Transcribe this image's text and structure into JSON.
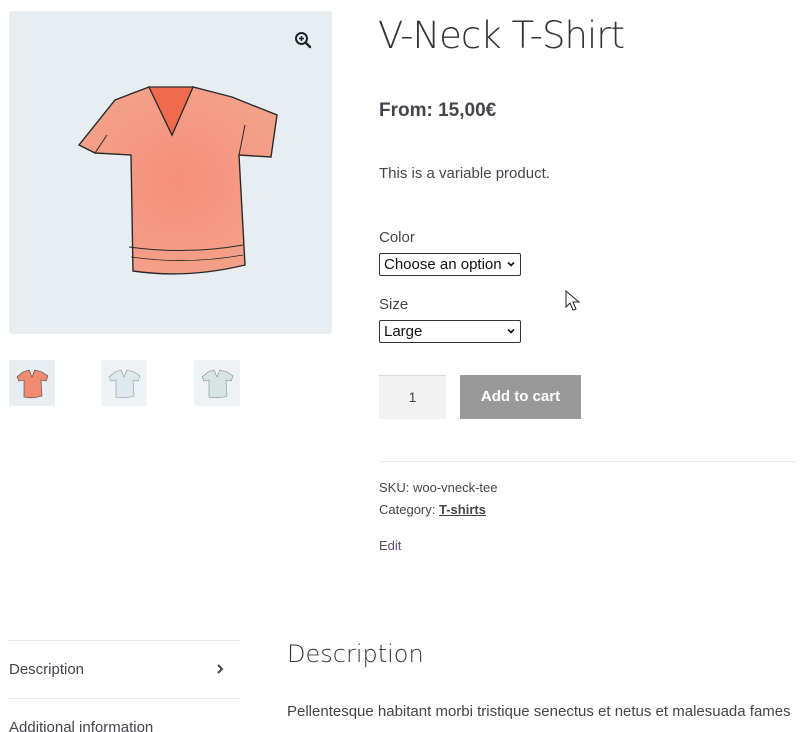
{
  "product": {
    "title": "V-Neck T-Shirt",
    "price": "From: 15,00€",
    "short_description": "This is a variable product.",
    "image_main": "pink-vneck-tshirt-image",
    "thumbnails": [
      "pink-tshirt-thumb",
      "white-tshirt-thumb",
      "gray-tshirt-thumb"
    ]
  },
  "variations": {
    "color_label": "Color",
    "color_selected": "Choose an option",
    "size_label": "Size",
    "size_selected": "Large"
  },
  "cart": {
    "quantity": "1",
    "add_label": "Add to cart"
  },
  "meta": {
    "sku_label": "SKU:",
    "sku_value": "woo-vneck-tee",
    "category_label": "Category:",
    "category_value": "T-shirts",
    "edit_label": "Edit"
  },
  "tabs": {
    "items": [
      {
        "label": "Description"
      },
      {
        "label": "Additional information"
      }
    ]
  },
  "panel": {
    "title": "Description",
    "text": "Pellentesque habitant morbi tristique senectus et netus et malesuada fames"
  },
  "colors": {
    "shirt_main": "#f08a70",
    "gallery_bg": "#e8edf2",
    "button_bg": "#999999"
  },
  "icons": {
    "zoom": "zoom-in-icon",
    "tab_arrow": "chevron-right-icon",
    "select_arrow": "chevron-down-icon",
    "cursor": "mouse-pointer-icon"
  }
}
